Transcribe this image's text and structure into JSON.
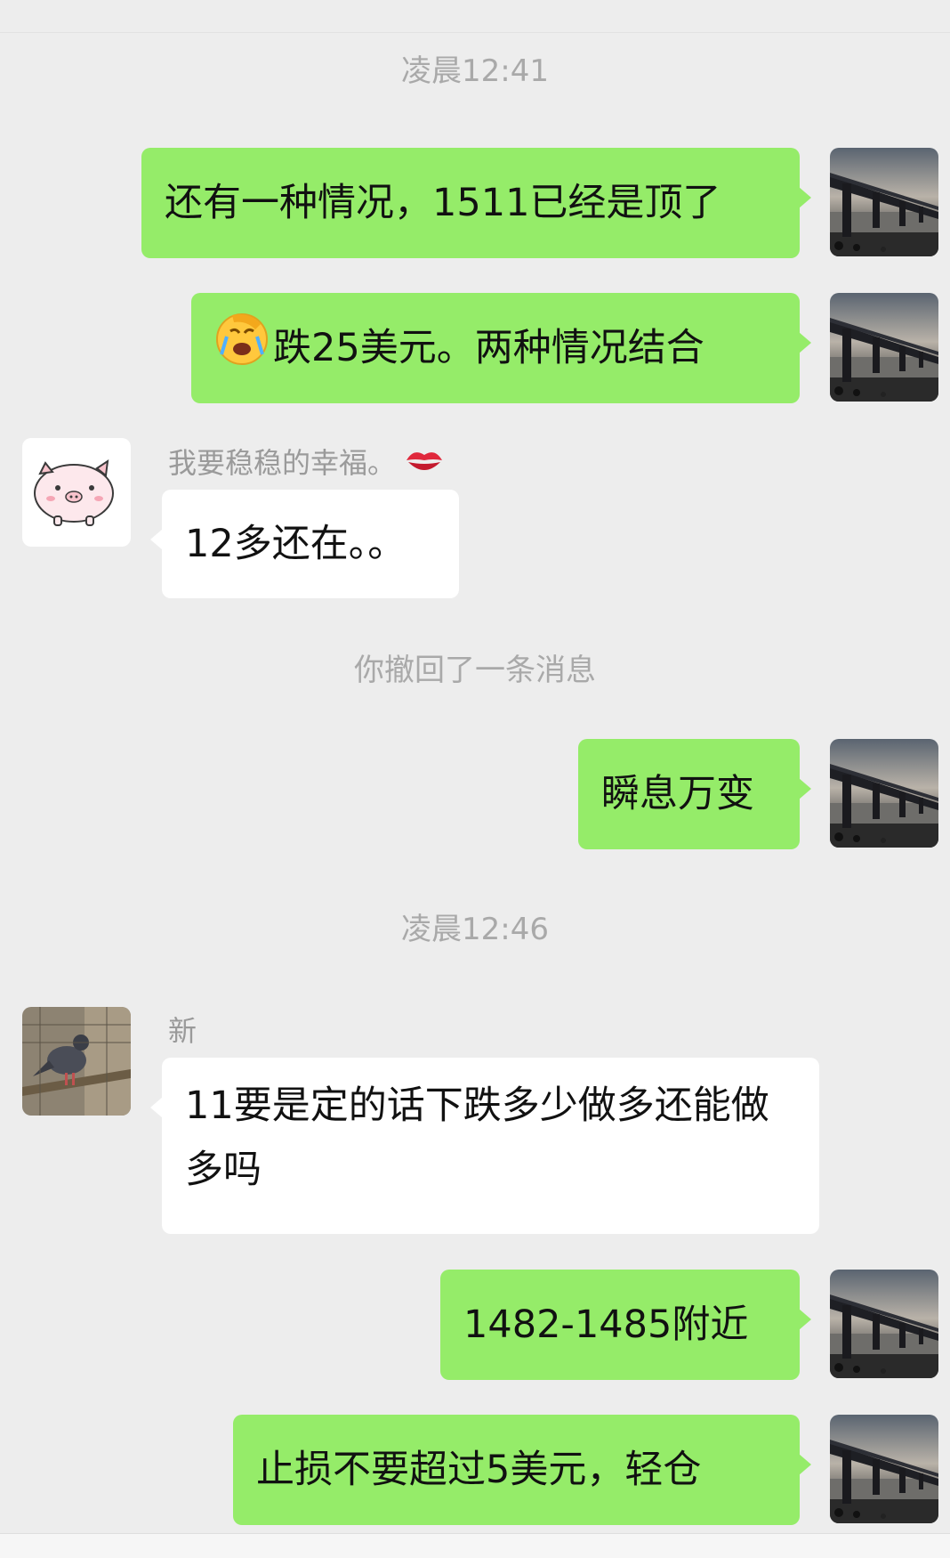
{
  "timestamps": [
    "凌晨12:41",
    "凌晨12:46"
  ],
  "system_message": "你撤回了一条消息",
  "messages": [
    {
      "direction": "out",
      "text": "还有一种情况，1511已经是顶了"
    },
    {
      "direction": "out",
      "emoji": "face-palm-crying-emoji",
      "text": "跌25美元。两种情况结合"
    },
    {
      "direction": "in",
      "sender": "我要稳稳的幸福。",
      "sender_emoji": "kiss-mark-emoji",
      "text": "12多还在。。"
    },
    {
      "direction": "out",
      "text": "瞬息万变"
    },
    {
      "direction": "in",
      "sender": "新",
      "text": "11要是定的话下跌多少做多还能做多吗"
    },
    {
      "direction": "out",
      "text": "1482-1485附近"
    },
    {
      "direction": "out",
      "text": "止损不要超过5美元，轻仓"
    }
  ],
  "colors": {
    "background": "#ededed",
    "outgoing_bubble": "#95ec69",
    "incoming_bubble": "#ffffff",
    "meta_text": "#a9a9a9"
  }
}
